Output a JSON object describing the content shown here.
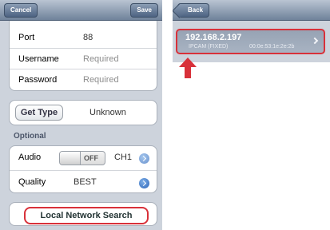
{
  "left_screen": {
    "navbar": {
      "cancel_label": "Cancel",
      "save_label": "Save"
    },
    "connection": {
      "port_label": "Port",
      "port_value": "88",
      "username_label": "Username",
      "username_placeholder": "Required",
      "password_label": "Password",
      "password_placeholder": "Required"
    },
    "type": {
      "button_label": "Get Type",
      "value": "Unknown"
    },
    "optional": {
      "section_label": "Optional",
      "audio_label": "Audio",
      "audio_toggle": "OFF",
      "audio_channel": "CH1",
      "quality_label": "Quality",
      "quality_value": "BEST"
    },
    "search_button_label": "Local Network Search"
  },
  "right_screen": {
    "navbar": {
      "back_label": "Back"
    },
    "device": {
      "ip": "192.168.2.197",
      "name": "IPCAM (FIXED)",
      "mac": "00:0e:53:1e:2e:2b"
    }
  },
  "colors": {
    "highlight_red": "#d8313a",
    "nav_blue": "#6f829a",
    "group_bg": "#cdd3dc"
  },
  "icons": [
    "disclosure-arrow-icon",
    "chevron-right-icon",
    "red-arrow-icon",
    "back-arrow-icon"
  ]
}
